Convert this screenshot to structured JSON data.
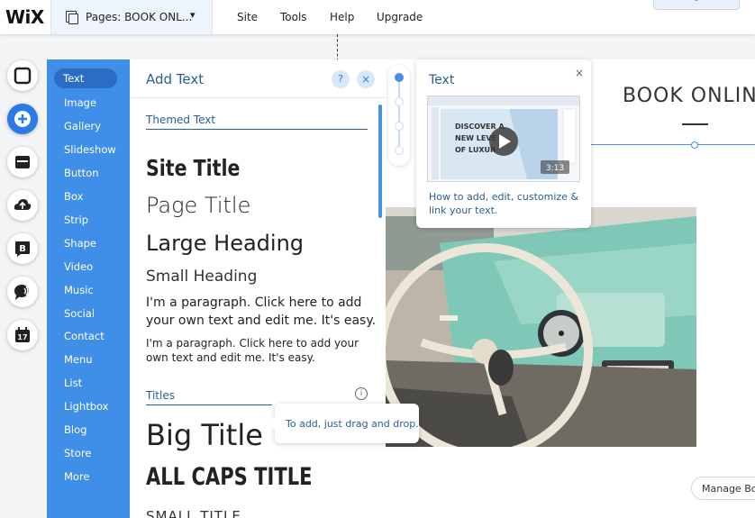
{
  "topbar": {
    "logo": "WiX",
    "pages_label": "Pages: BOOK ONL...",
    "menu": [
      "Site",
      "Tools",
      "Help",
      "Upgrade"
    ],
    "collapse_icon": "caret-up"
  },
  "categories": [
    "Text",
    "Image",
    "Gallery",
    "Slideshow",
    "Button",
    "Box",
    "Strip",
    "Shape",
    "Video",
    "Music",
    "Social",
    "Contact",
    "Menu",
    "List",
    "Lightbox",
    "Blog",
    "Store",
    "More"
  ],
  "active_category": "Text",
  "rail_icons": [
    "pages-square-icon",
    "add-plus-icon",
    "store-icon",
    "upload-icon",
    "blog-b-icon",
    "chat-icon",
    "calendar-17-icon"
  ],
  "panel": {
    "title": "Add Text",
    "help": "?",
    "close": "×",
    "themed_section": "Themed Text",
    "site_title": "Site Title",
    "page_title": "Page Title",
    "large_heading": "Large Heading",
    "small_heading": "Small Heading",
    "para_big_1": "I'm a paragraph. Click here to add",
    "para_big_2": "your own text and edit me. It's easy.",
    "para_small_1": "I'm a paragraph. Click here to add your",
    "para_small_2": "own text and edit me. It's easy.",
    "titles_section": "Titles",
    "info": "i",
    "big_title": "Big Title",
    "caps_title": "ALL CAPS TITLE",
    "small_title": "SMALL TITLE"
  },
  "tooltip": "To add, just drag and drop.",
  "video_card": {
    "title": "Text",
    "close": "×",
    "thumb_text_1": "DISCOVER A",
    "thumb_text_2": "NEW LEVE",
    "thumb_text_3": "OF LUXUR",
    "duration": "3:13",
    "caption": "How to add, edit, customize & link your text."
  },
  "canvas": {
    "heading": "BOOK ONLIN",
    "manage_button": "Manage Boo"
  },
  "colors": {
    "accent": "#3f8ee8",
    "accent_dark": "#2b6cc4",
    "link_text": "#2a5d93",
    "guide": "#4a90e2",
    "dashboard_teal": "#7fc8b8"
  }
}
